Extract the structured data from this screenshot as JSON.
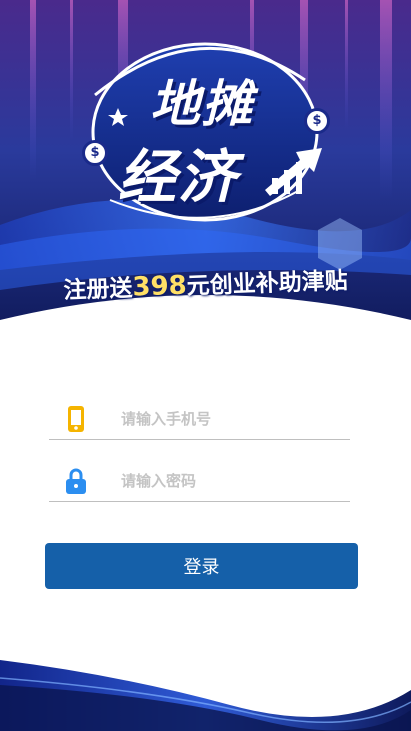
{
  "banner": {
    "title_line1": "地摊",
    "title_line2": "经济",
    "promo_prefix": "注册送",
    "promo_amount": "398",
    "promo_suffix": "元创业补助津贴",
    "coin_symbol": "$",
    "colors": {
      "navy": "#1a2a8a",
      "accent_yellow": "#ffe066",
      "purple": "#6a2b9a"
    }
  },
  "login_form": {
    "phone_placeholder": "请输入手机号",
    "password_placeholder": "请输入密码",
    "submit_label": "登录",
    "icons": {
      "phone": "phone-icon",
      "lock": "lock-icon"
    },
    "colors": {
      "button": "#1560a9",
      "phone_icon": "#f5b400",
      "lock_icon": "#2b8ef0"
    }
  }
}
